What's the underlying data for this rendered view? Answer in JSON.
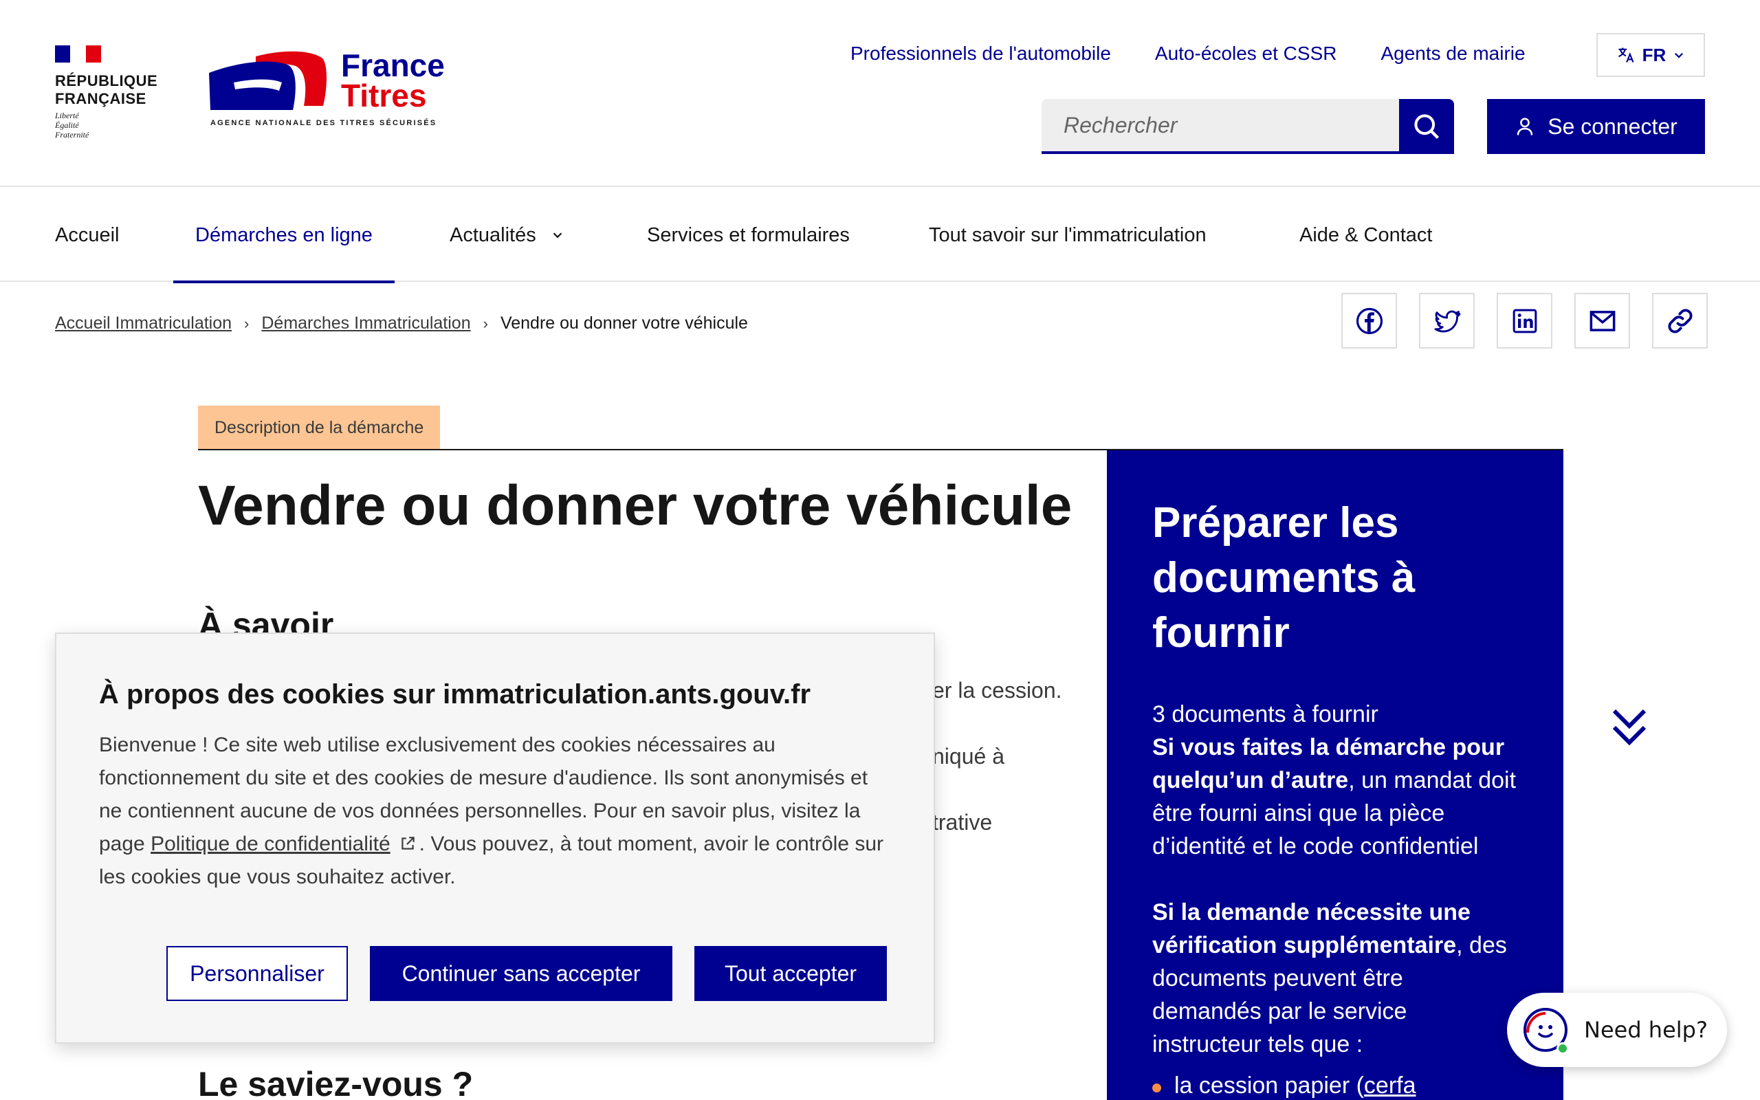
{
  "header": {
    "republic": {
      "line1": "RÉPUBLIQUE",
      "line2": "FRANÇAISE",
      "motto1": "Liberté",
      "motto2": "Égalité",
      "motto3": "Fraternité"
    },
    "brand": {
      "line1": "France",
      "line2": "Titres",
      "subtitle": "AGENCE NATIONALE DES TITRES SÉCURISÉS"
    },
    "top_links": [
      "Professionnels de l'automobile",
      "Auto-écoles et CSSR",
      "Agents de mairie"
    ],
    "language": "FR",
    "search": {
      "placeholder": "Rechercher"
    },
    "login_label": "Se connecter"
  },
  "nav": {
    "items": [
      {
        "label": "Accueil"
      },
      {
        "label": "Démarches en ligne",
        "active": true
      },
      {
        "label": "Actualités",
        "has_dropdown": true
      },
      {
        "label": "Services et formulaires"
      },
      {
        "label": "Tout savoir sur l'immatriculation"
      },
      {
        "label": "Aide & Contact"
      }
    ]
  },
  "breadcrumb": {
    "items": [
      "Accueil Immatriculation",
      "Démarches Immatriculation"
    ],
    "current": "Vendre ou donner votre véhicule"
  },
  "share": {
    "icons": [
      "facebook-icon",
      "twitter-icon",
      "linkedin-icon",
      "mail-icon",
      "link-icon"
    ]
  },
  "main": {
    "tag": "Description de la démarche",
    "title": "Vendre ou donner votre véhicule",
    "section_partial": "À savoir",
    "visible_fragments": [
      "er la cession.",
      "niqué à",
      "trative"
    ],
    "did_you_know": "Le saviez-vous ?"
  },
  "sidebar": {
    "title": "Préparer les documents à fournir",
    "count": "3 documents à fournir",
    "para1_bold": "Si vous faites la démarche pour quelqu’un d’autre",
    "para1_rest": ", un mandat doit être fourni ainsi que la pièce d’identité et le code confidentiel",
    "para2_bold": "Si la demande nécessite une vérification supplémentaire",
    "para2_rest": ", des documents peuvent être demandés par le service instructeur tels que :",
    "bullet1_prefix": "la cession papier (",
    "bullet1_link": "cerfa"
  },
  "cookie": {
    "title": "À propos des cookies sur immatriculation.ants.gouv.fr",
    "text_before": "Bienvenue ! Ce site web utilise exclusivement des cookies nécessaires au fonctionnement du site et des cookies de mesure d'audience. Ils sont anonymisés et ne contiennent aucune de vos données personnelles. Pour en savoir plus, visitez la page ",
    "link": "Politique de confidentialité",
    "text_after": ". Vous pouvez, à tout moment, avoir le contrôle sur les cookies que vous souhaitez activer.",
    "buttons": {
      "customize": "Personnaliser",
      "reject": "Continuer sans accepter",
      "accept": "Tout accepter"
    }
  },
  "help_widget": {
    "label": "Need help?"
  },
  "colors": {
    "primary": "#000091",
    "red": "#e1000f",
    "tag_bg": "#fcc593",
    "bullet": "#fc8c42",
    "online": "#2db84d"
  }
}
